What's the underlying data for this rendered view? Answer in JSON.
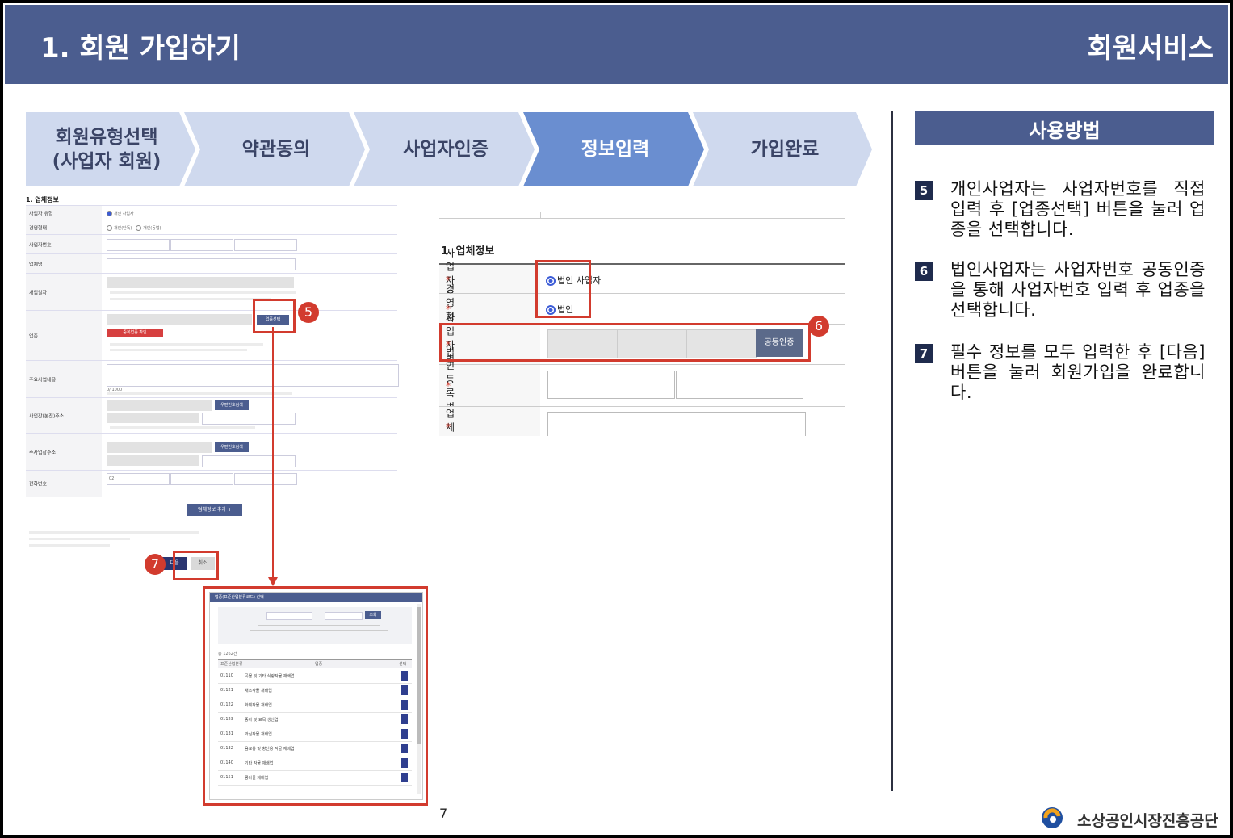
{
  "header": {
    "title": "1. 회원 가입하기",
    "section": "회원서비스"
  },
  "steps": [
    {
      "line1": "회원유형선택",
      "line2": "(사업자 회원)",
      "active": false
    },
    {
      "line1": "약관동의",
      "line2": "",
      "active": false
    },
    {
      "line1": "사업자인증",
      "line2": "",
      "active": false
    },
    {
      "line1": "정보입력",
      "line2": "",
      "active": true
    },
    {
      "line1": "가입완료",
      "line2": "",
      "active": false
    }
  ],
  "howto": {
    "title": "사용방법",
    "items": [
      {
        "num": "5",
        "text": "개인사업자는 사업자번호를 직접 입력 후 [업종선택] 버튼을 눌러 업종을 선택합니다."
      },
      {
        "num": "6",
        "text": "법인사업자는 사업자번호 공동인증을 통해 사업자번호 입력 후 업종을 선택합니다."
      },
      {
        "num": "7",
        "text": "필수 정보를 모두 입력한 후 [다음] 버튼을 눌러 회원가입을 완료합니다."
      }
    ]
  },
  "form_small": {
    "section_title": "1. 업체정보",
    "rows": [
      "사업자 유형",
      "경영형태",
      "사업자번호",
      "업체명",
      "개업일자",
      "업종",
      "주요사업내용",
      "사업장(본점)주소",
      "주사업장주소",
      "전화번호"
    ],
    "type_option": "개인 사업자",
    "mgmt_options": [
      "개인(단독)",
      "개인(동업)"
    ],
    "industry_button": "업종선택",
    "industry_red_button": "중복업종 확인",
    "zip_button": "우편번호검색",
    "phone_prefix": "02",
    "add_button": "업체정보 추가 +",
    "next_button": "다음",
    "cancel_button": "취소",
    "char_count": "0/ 1000"
  },
  "form_zoom": {
    "section_title": "1. 업체정보",
    "rows": [
      {
        "label": "사업자 유형",
        "value": "법인 사업자"
      },
      {
        "label": "경영형태",
        "value": "법인"
      },
      {
        "label": "사업자번호",
        "value": ""
      },
      {
        "label": "법인등록번호",
        "value": ""
      },
      {
        "label": "업체명",
        "value": ""
      }
    ],
    "cert_button": "공동인증"
  },
  "popup": {
    "title": "업종(표준산업분류코드) 선택",
    "search_button": "조회",
    "count": "총 1262건",
    "col_code": "표준산업분류",
    "col_name": "업종",
    "col_select": "선택",
    "rows": [
      {
        "code": "01110",
        "name": "곡물 및 기타 식량작물 재배업"
      },
      {
        "code": "01121",
        "name": "채소작물 재배업"
      },
      {
        "code": "01122",
        "name": "화훼작물 재배업"
      },
      {
        "code": "01123",
        "name": "종자 및 묘목 생산업"
      },
      {
        "code": "01131",
        "name": "과실작물 재배업"
      },
      {
        "code": "01132",
        "name": "음료용 및 향신용 작물 재배업"
      },
      {
        "code": "01140",
        "name": "기타 작물 재배업"
      },
      {
        "code": "01151",
        "name": "콩나물 재배업"
      }
    ]
  },
  "callouts": [
    "5",
    "6",
    "7"
  ],
  "page_number": "7",
  "footer_logo": "소상공인시장진흥공단"
}
